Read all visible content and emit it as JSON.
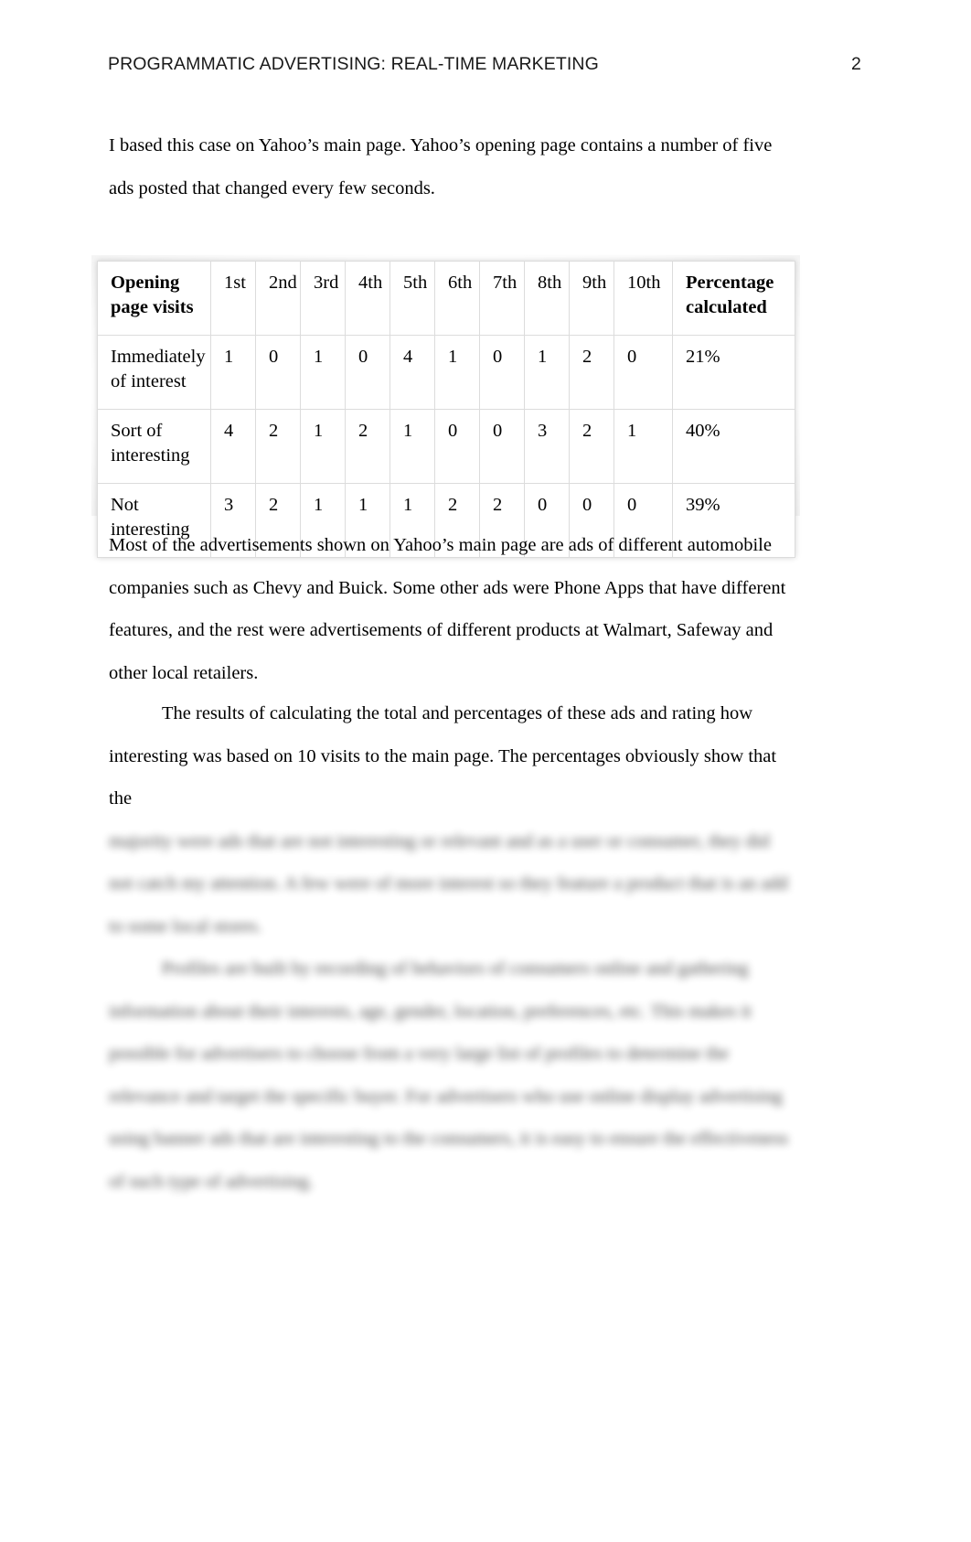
{
  "header": {
    "title": "PROGRAMMATIC ADVERTISING: REAL-TIME MARKETING",
    "page_number": "2"
  },
  "paragraphs": {
    "intro": "I based this case on Yahoo’s main page. Yahoo’s opening page contains a number of five ads posted that changed every few seconds.",
    "ads": "Most of the advertisements shown on Yahoo’s main page are ads of different automobile companies such as Chevy and Buick. Some other ads were Phone Apps that have different features, and the rest were advertisements of different products at Walmart, Safeway and other local retailers.",
    "results_visible": "The results of calculating the total and percentages of these ads and rating how interesting was based on 10 visits to the main page. The percentages obviously show that the",
    "results_blurred": "majority were ads that are not interesting or relevant and as a user or consumer, they did not catch my attention. A few were of more interest so they feature a product that is an add to some local stores.",
    "profile_blurred": "Profiles are built by recording of behaviors of consumers online and gathering information about their interests, age, gender, location, preferences, etc. This makes it possible for advertisers to choose from a very large list of profiles to determine the relevance and target the specific buyer. For advertisers who use online display advertising using banner ads that are interesting to the consumers, it is easy to ensure the effectiveness of such type of advertising."
  },
  "table": {
    "columns": [
      "Opening page visits",
      "1st",
      "2nd",
      "3rd",
      "4th",
      "5th",
      "6th",
      "7th",
      "8th",
      "9th",
      "10th",
      "Percentage calculated"
    ],
    "rows": [
      {
        "label": "Immediately of interest",
        "values": [
          "1",
          "0",
          "1",
          "0",
          "4",
          "1",
          "0",
          "1",
          "2",
          "0"
        ],
        "percentage": "21%"
      },
      {
        "label": "Sort of interesting",
        "values": [
          "4",
          "2",
          "1",
          "2",
          "1",
          "0",
          "0",
          "3",
          "2",
          "1"
        ],
        "percentage": "40%"
      },
      {
        "label": "Not interesting",
        "values": [
          "3",
          "2",
          "1",
          "1",
          "1",
          "2",
          "2",
          "0",
          "0",
          "0"
        ],
        "percentage": "39%"
      }
    ]
  },
  "colors": {
    "text": "#000000",
    "table_border": "#dcdcdc",
    "page_background": "#ffffff"
  }
}
